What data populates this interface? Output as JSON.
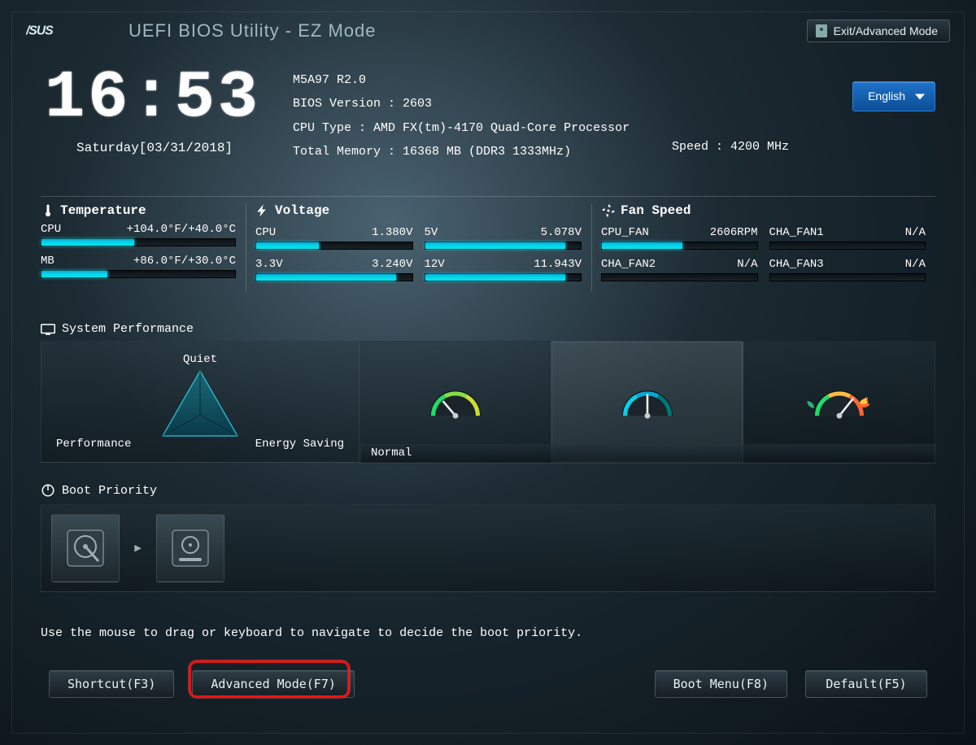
{
  "header": {
    "title": "UEFI BIOS Utility - EZ Mode",
    "exit_label": "Exit/Advanced Mode",
    "brand": "ASUS"
  },
  "clock": {
    "time": "16:53",
    "date": "Saturday[03/31/2018]"
  },
  "specs": {
    "board": "M5A97 R2.0",
    "bios_label": "BIOS Version : ",
    "bios_value": "2603",
    "cpu_label": "CPU Type : ",
    "cpu_value": "AMD FX(tm)-4170 Quad-Core Processor",
    "speed_label": "Speed : ",
    "speed_value": "4200 MHz",
    "mem_label": "Total Memory : ",
    "mem_value": "16368 MB (DDR3 1333MHz)"
  },
  "language": "English",
  "temperature": {
    "title": "Temperature",
    "rows": [
      {
        "name": "CPU",
        "value": "+104.0°F/+40.0°C",
        "fill": 48
      },
      {
        "name": "MB",
        "value": "+86.0°F/+30.0°C",
        "fill": 34
      }
    ]
  },
  "voltage": {
    "title": "Voltage",
    "left": [
      {
        "name": "CPU",
        "value": "1.380V",
        "fill": 40
      },
      {
        "name": "3.3V",
        "value": "3.240V",
        "fill": 90
      }
    ],
    "right": [
      {
        "name": "5V",
        "value": "5.078V",
        "fill": 90
      },
      {
        "name": "12V",
        "value": "11.943V",
        "fill": 90
      }
    ]
  },
  "fan": {
    "title": "Fan Speed",
    "left": [
      {
        "name": "CPU_FAN",
        "value": "2606RPM",
        "fill": 52
      },
      {
        "name": "CHA_FAN2",
        "value": "N/A",
        "fill": 0
      }
    ],
    "right": [
      {
        "name": "CHA_FAN1",
        "value": "N/A",
        "fill": 0
      },
      {
        "name": "CHA_FAN3",
        "value": "N/A",
        "fill": 0
      }
    ]
  },
  "sysperf": {
    "title": "System Performance",
    "labels": {
      "quiet": "Quiet",
      "performance": "Performance",
      "energy": "Energy Saving"
    },
    "caption": "Normal",
    "selected_index": 1
  },
  "boot": {
    "title": "Boot Priority",
    "hint": "Use the mouse to drag or keyboard to navigate to decide the boot priority."
  },
  "footer": {
    "shortcut": "Shortcut(F3)",
    "advanced": "Advanced Mode(F7)",
    "bootmenu": "Boot Menu(F8)",
    "default": "Default(F5)"
  }
}
